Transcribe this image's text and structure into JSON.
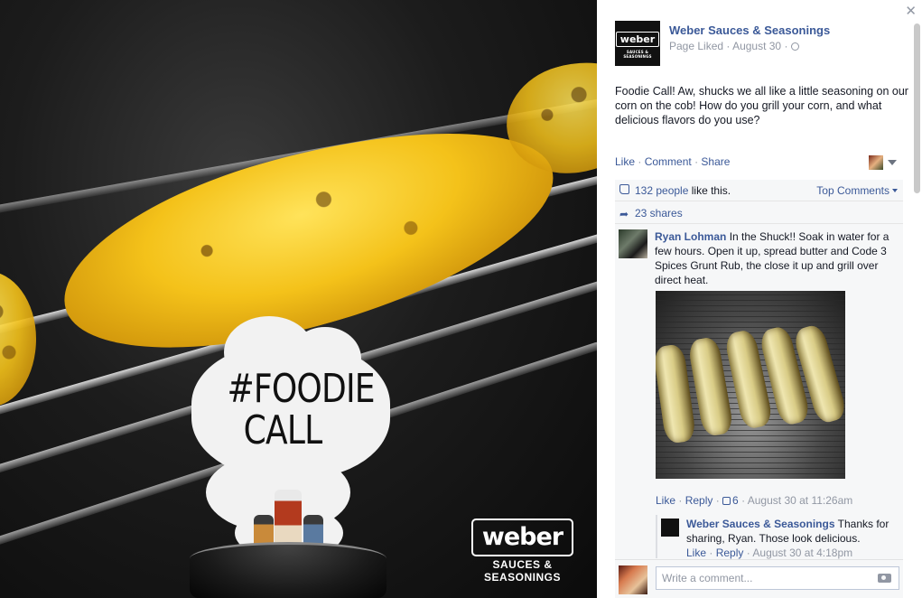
{
  "photo": {
    "foodie_line1": "#FOODIE",
    "foodie_line2": "CALL",
    "logo_word": "weber",
    "logo_sub": "SAUCES & SEASONINGS"
  },
  "post": {
    "page_name": "Weber Sauces & Seasonings",
    "page_liked": "Page Liked",
    "date": "August 30",
    "text": "Foodie Call! Aw, shucks we all like a little seasoning on our corn on the cob! How do you grill your corn, and what delicious flavors do you use?",
    "actions": {
      "like": "Like",
      "comment": "Comment",
      "share": "Share"
    }
  },
  "ufi": {
    "likes_count": "132 people",
    "likes_suffix": "like this.",
    "top_comments": "Top Comments",
    "shares": "23 shares"
  },
  "comments": [
    {
      "author": "Ryan Lohman",
      "text": "In the Shuck!! Soak in water for a few hours. Open it up, spread butter and Code 3 Spices Grunt Rub, the close it up and grill over direct heat.",
      "like": "Like",
      "reply": "Reply",
      "likes": "6",
      "time": "August 30 at 11:26am"
    }
  ],
  "reply": {
    "author": "Weber Sauces & Seasonings",
    "text": "Thanks for sharing, Ryan. Those look delicious.",
    "like": "Like",
    "reply": "Reply",
    "time": "August 30 at 4:18pm"
  },
  "writer": {
    "placeholder": "Write a comment..."
  },
  "colors": {
    "link": "#3b5998",
    "meta": "#9197a3",
    "ufi_bg": "#f6f7f8"
  },
  "icons": [
    "close-icon",
    "globe-icon",
    "thumb-up-icon",
    "share-arrow-icon",
    "chevron-down-icon",
    "camera-icon"
  ]
}
